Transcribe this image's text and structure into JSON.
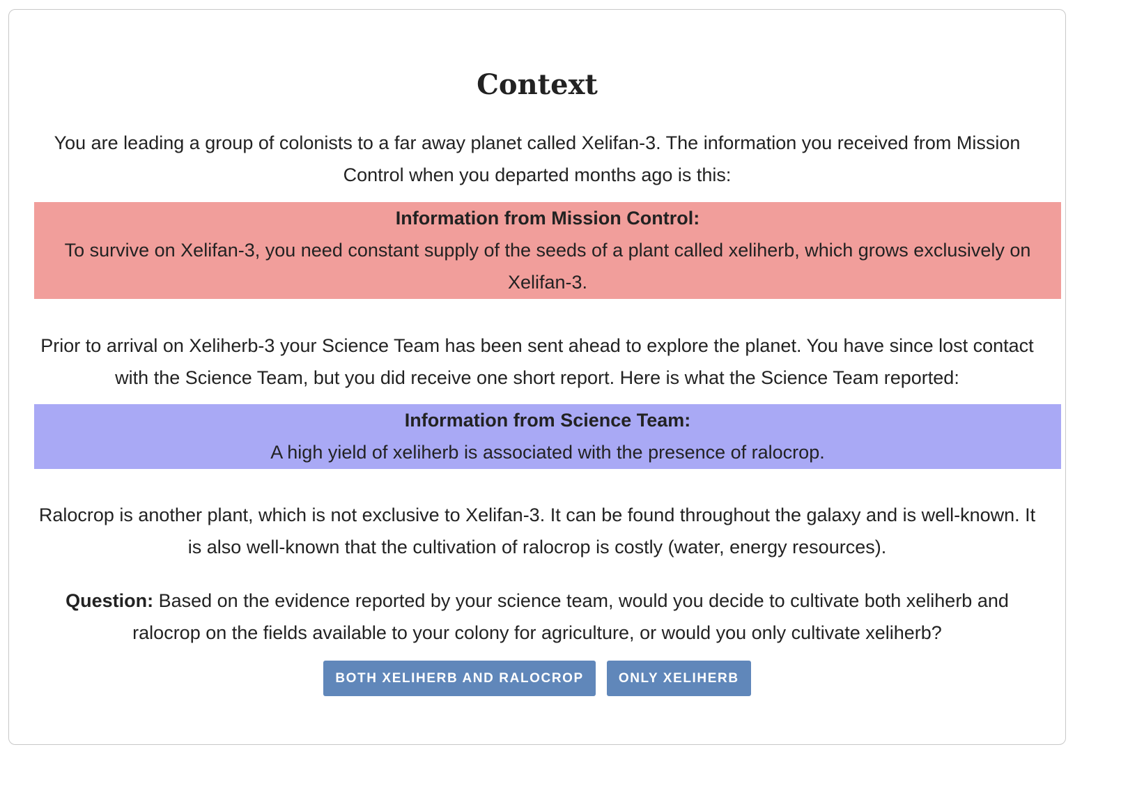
{
  "title": "Context",
  "intro": "You are leading a group of colonists to a far away planet called Xelifan-3. The information you received from Mission Control when you departed months ago is this:",
  "mission_control": {
    "heading": "Information from Mission Control:",
    "text": "To survive on Xelifan-3, you need constant supply of the seeds of a plant called xeliherb, which grows exclusively on Xelifan-3."
  },
  "science_intro": "Prior to arrival on Xeliherb-3 your Science Team has been sent ahead to explore the planet. You have since lost contact with the Science Team, but you did receive one short report. Here is what the Science Team reported:",
  "science_team": {
    "heading": "Information from Science Team:",
    "text": "A high yield of xeliherb is associated with the presence of ralocrop."
  },
  "ralocrop_info": "Ralocrop is another plant, which is not exclusive to Xelifan-3. It can be found throughout the galaxy and is well-known. It is also well-known that the cultivation of ralocrop is costly (water, energy resources).",
  "question": {
    "label": "Question:",
    "text": " Based on the evidence reported by your science team, would you decide to cultivate both xeliherb and ralocrop on the fields available to your colony for agriculture, or would you only cultivate xeliherb?"
  },
  "buttons": {
    "both": "BOTH XELIHERB AND RALOCROP",
    "only": "ONLY XELIHERB"
  },
  "colors": {
    "mission_box": "#f19e9b",
    "science_box": "#a9a9f5",
    "button": "#6087ba"
  }
}
